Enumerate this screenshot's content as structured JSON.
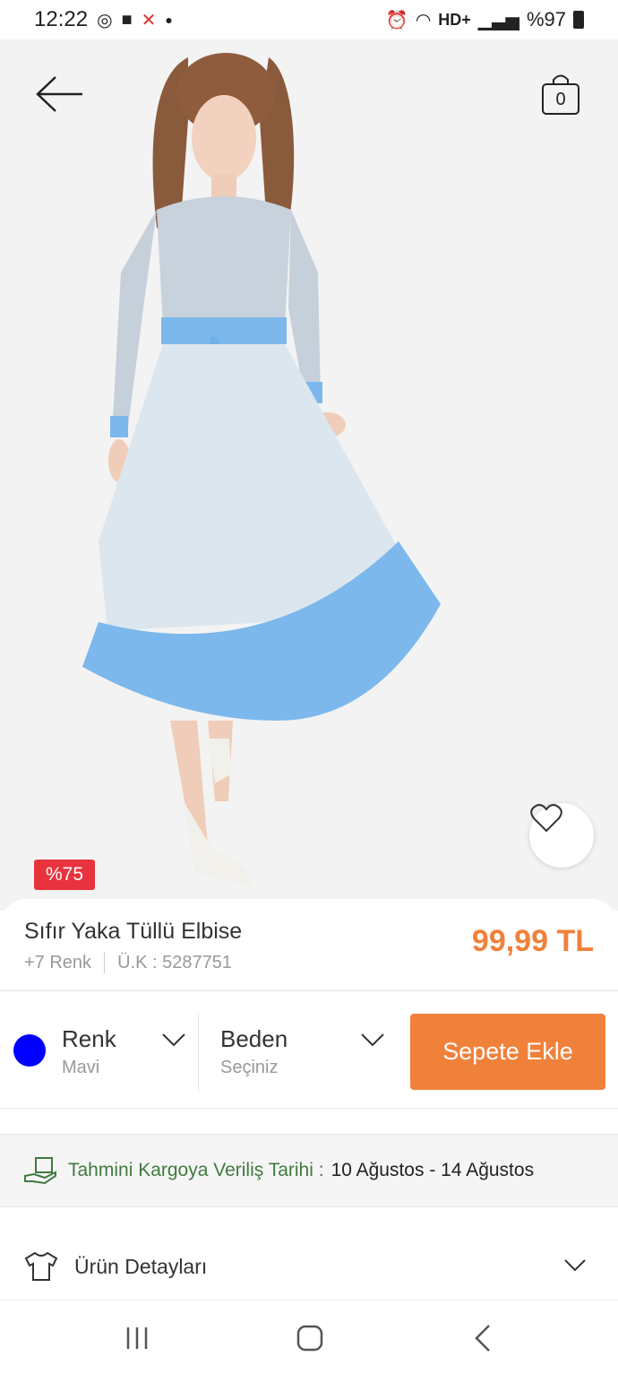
{
  "status_bar": {
    "time": "12:22",
    "network": "HD+",
    "battery": "%97"
  },
  "header": {
    "cart_count": "0"
  },
  "product": {
    "discount_badge": "%75",
    "title": "Sıfır Yaka Tüllü Elbise",
    "color_count": "+7 Renk",
    "sku": "Ü.K : 5287751",
    "price": "99,99 TL",
    "dress_color": "#7cb8ec"
  },
  "selectors": {
    "color_label": "Renk",
    "color_value": "Mavi",
    "color_swatch": "#0000ff",
    "size_label": "Beden",
    "size_value": "Seçiniz",
    "add_to_cart": "Sepete Ekle",
    "accent": "#f0813a"
  },
  "cargo": {
    "label": "Tahmini Kargoya Veriliş Tarihi :",
    "dates": "10 Ağustos - 14 Ağustos"
  },
  "details": {
    "label": "Ürün Detayları"
  },
  "icons": [
    "back-arrow-icon",
    "shopping-bag-icon",
    "heart-icon",
    "chevron-down-icon",
    "cargo-box-icon",
    "tshirt-icon",
    "recents-icon",
    "home-icon",
    "nav-back-icon"
  ]
}
